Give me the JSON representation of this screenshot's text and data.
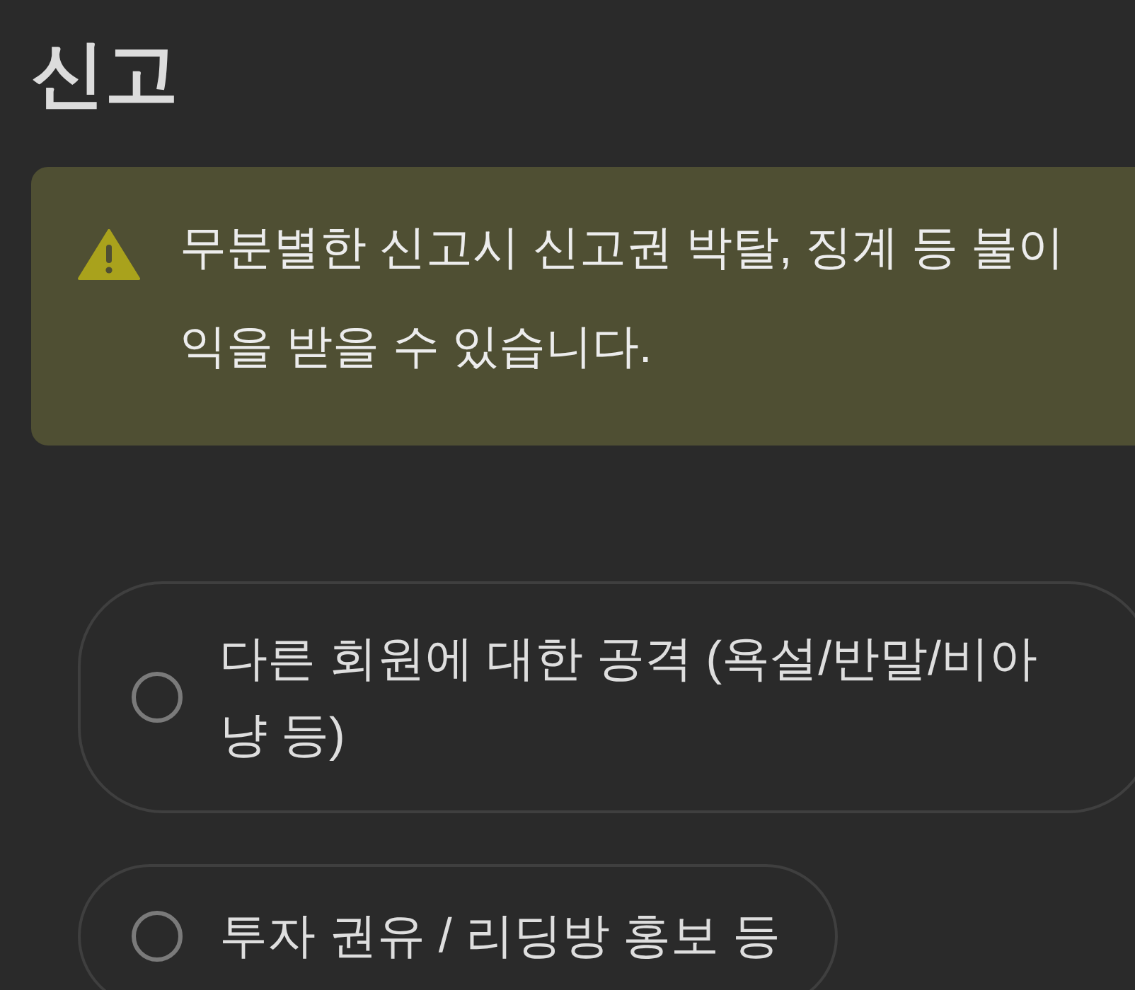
{
  "title": "신고",
  "warning": {
    "text": "무분별한 신고시 신고권 박탈, 징계 등 불이익을 받을 수 있습니다."
  },
  "options": [
    {
      "label": "다른 회원에 대한 공격 (욕설/반말/비아냥 등)",
      "selected": false
    },
    {
      "label": "투자 권유 / 리딩방 홍보 등",
      "selected": false
    }
  ]
}
